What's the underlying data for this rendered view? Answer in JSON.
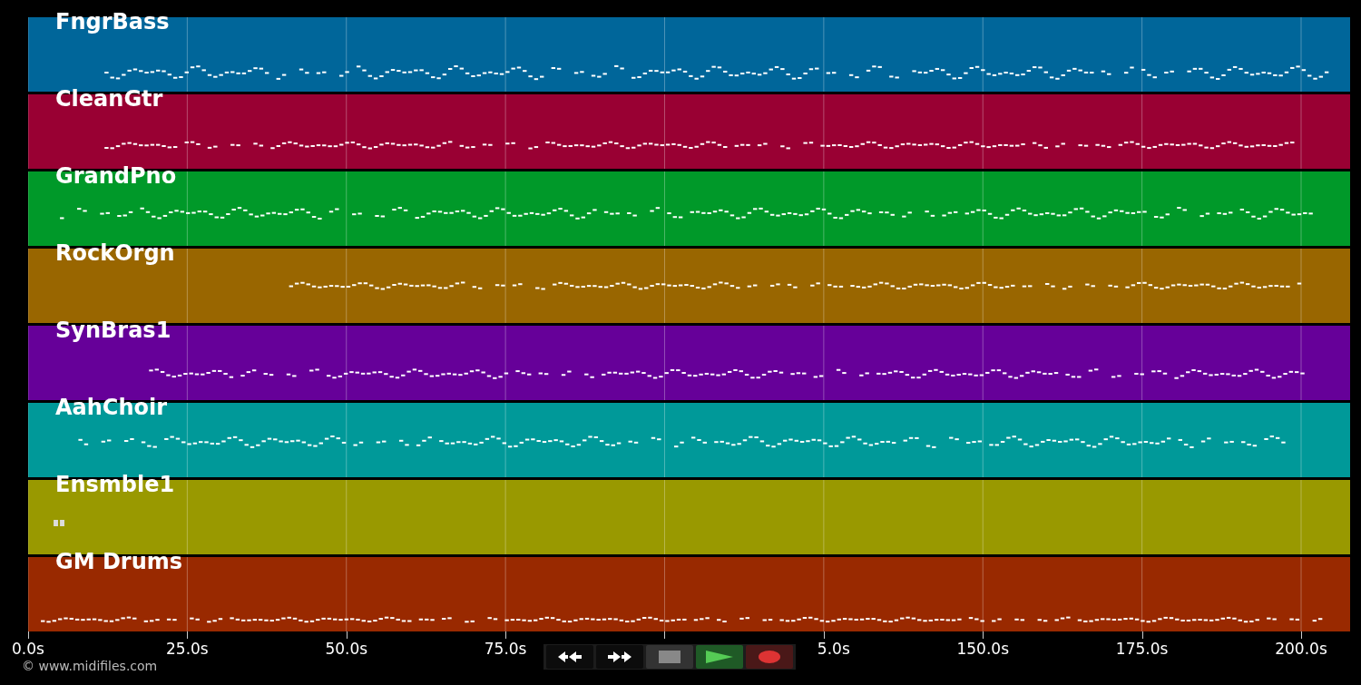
{
  "tracks": [
    {
      "name": "FngrBass",
      "color": "#00669a"
    },
    {
      "name": "CleanGtr",
      "color": "#990033"
    },
    {
      "name": "GrandPno",
      "color": "#009929"
    },
    {
      "name": "RockOrgn",
      "color": "#996600"
    },
    {
      "name": "SynBras1",
      "color": "#660099"
    },
    {
      "name": "AahChoir",
      "color": "#009999"
    },
    {
      "name": "Ensmble1",
      "color": "#999900"
    },
    {
      "name": "GM Drums",
      "color": "#992900"
    }
  ],
  "axis": {
    "labels_left": [
      "0.0s",
      "25.0s",
      "50.0s",
      "75.0s"
    ],
    "partly_covered_label": "5.0s",
    "labels_right": [
      "150.0s",
      "175.0s",
      "200.0s"
    ]
  },
  "transport": [
    {
      "kind": "rewind"
    },
    {
      "kind": "forward"
    },
    {
      "kind": "stop"
    },
    {
      "kind": "play"
    },
    {
      "kind": "record"
    }
  ],
  "copyright": "© www.midifiles.com"
}
